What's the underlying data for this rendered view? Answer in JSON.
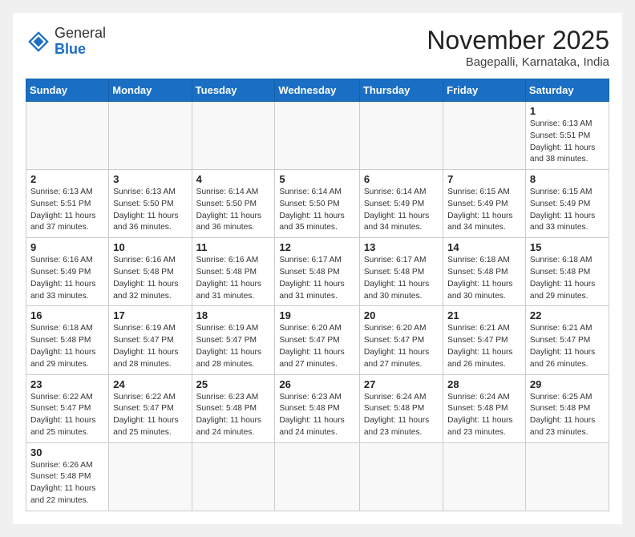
{
  "logo": {
    "general": "General",
    "blue": "Blue"
  },
  "header": {
    "month": "November 2025",
    "location": "Bagepalli, Karnataka, India"
  },
  "weekdays": [
    "Sunday",
    "Monday",
    "Tuesday",
    "Wednesday",
    "Thursday",
    "Friday",
    "Saturday"
  ],
  "weeks": [
    [
      {
        "day": "",
        "text": ""
      },
      {
        "day": "",
        "text": ""
      },
      {
        "day": "",
        "text": ""
      },
      {
        "day": "",
        "text": ""
      },
      {
        "day": "",
        "text": ""
      },
      {
        "day": "",
        "text": ""
      },
      {
        "day": "1",
        "text": "Sunrise: 6:13 AM\nSunset: 5:51 PM\nDaylight: 11 hours\nand 38 minutes."
      }
    ],
    [
      {
        "day": "2",
        "text": "Sunrise: 6:13 AM\nSunset: 5:51 PM\nDaylight: 11 hours\nand 37 minutes."
      },
      {
        "day": "3",
        "text": "Sunrise: 6:13 AM\nSunset: 5:50 PM\nDaylight: 11 hours\nand 36 minutes."
      },
      {
        "day": "4",
        "text": "Sunrise: 6:14 AM\nSunset: 5:50 PM\nDaylight: 11 hours\nand 36 minutes."
      },
      {
        "day": "5",
        "text": "Sunrise: 6:14 AM\nSunset: 5:50 PM\nDaylight: 11 hours\nand 35 minutes."
      },
      {
        "day": "6",
        "text": "Sunrise: 6:14 AM\nSunset: 5:49 PM\nDaylight: 11 hours\nand 34 minutes."
      },
      {
        "day": "7",
        "text": "Sunrise: 6:15 AM\nSunset: 5:49 PM\nDaylight: 11 hours\nand 34 minutes."
      },
      {
        "day": "8",
        "text": "Sunrise: 6:15 AM\nSunset: 5:49 PM\nDaylight: 11 hours\nand 33 minutes."
      }
    ],
    [
      {
        "day": "9",
        "text": "Sunrise: 6:16 AM\nSunset: 5:49 PM\nDaylight: 11 hours\nand 33 minutes."
      },
      {
        "day": "10",
        "text": "Sunrise: 6:16 AM\nSunset: 5:48 PM\nDaylight: 11 hours\nand 32 minutes."
      },
      {
        "day": "11",
        "text": "Sunrise: 6:16 AM\nSunset: 5:48 PM\nDaylight: 11 hours\nand 31 minutes."
      },
      {
        "day": "12",
        "text": "Sunrise: 6:17 AM\nSunset: 5:48 PM\nDaylight: 11 hours\nand 31 minutes."
      },
      {
        "day": "13",
        "text": "Sunrise: 6:17 AM\nSunset: 5:48 PM\nDaylight: 11 hours\nand 30 minutes."
      },
      {
        "day": "14",
        "text": "Sunrise: 6:18 AM\nSunset: 5:48 PM\nDaylight: 11 hours\nand 30 minutes."
      },
      {
        "day": "15",
        "text": "Sunrise: 6:18 AM\nSunset: 5:48 PM\nDaylight: 11 hours\nand 29 minutes."
      }
    ],
    [
      {
        "day": "16",
        "text": "Sunrise: 6:18 AM\nSunset: 5:48 PM\nDaylight: 11 hours\nand 29 minutes."
      },
      {
        "day": "17",
        "text": "Sunrise: 6:19 AM\nSunset: 5:47 PM\nDaylight: 11 hours\nand 28 minutes."
      },
      {
        "day": "18",
        "text": "Sunrise: 6:19 AM\nSunset: 5:47 PM\nDaylight: 11 hours\nand 28 minutes."
      },
      {
        "day": "19",
        "text": "Sunrise: 6:20 AM\nSunset: 5:47 PM\nDaylight: 11 hours\nand 27 minutes."
      },
      {
        "day": "20",
        "text": "Sunrise: 6:20 AM\nSunset: 5:47 PM\nDaylight: 11 hours\nand 27 minutes."
      },
      {
        "day": "21",
        "text": "Sunrise: 6:21 AM\nSunset: 5:47 PM\nDaylight: 11 hours\nand 26 minutes."
      },
      {
        "day": "22",
        "text": "Sunrise: 6:21 AM\nSunset: 5:47 PM\nDaylight: 11 hours\nand 26 minutes."
      }
    ],
    [
      {
        "day": "23",
        "text": "Sunrise: 6:22 AM\nSunset: 5:47 PM\nDaylight: 11 hours\nand 25 minutes."
      },
      {
        "day": "24",
        "text": "Sunrise: 6:22 AM\nSunset: 5:47 PM\nDaylight: 11 hours\nand 25 minutes."
      },
      {
        "day": "25",
        "text": "Sunrise: 6:23 AM\nSunset: 5:48 PM\nDaylight: 11 hours\nand 24 minutes."
      },
      {
        "day": "26",
        "text": "Sunrise: 6:23 AM\nSunset: 5:48 PM\nDaylight: 11 hours\nand 24 minutes."
      },
      {
        "day": "27",
        "text": "Sunrise: 6:24 AM\nSunset: 5:48 PM\nDaylight: 11 hours\nand 23 minutes."
      },
      {
        "day": "28",
        "text": "Sunrise: 6:24 AM\nSunset: 5:48 PM\nDaylight: 11 hours\nand 23 minutes."
      },
      {
        "day": "29",
        "text": "Sunrise: 6:25 AM\nSunset: 5:48 PM\nDaylight: 11 hours\nand 23 minutes."
      }
    ],
    [
      {
        "day": "30",
        "text": "Sunrise: 6:26 AM\nSunset: 5:48 PM\nDaylight: 11 hours\nand 22 minutes."
      },
      {
        "day": "",
        "text": ""
      },
      {
        "day": "",
        "text": ""
      },
      {
        "day": "",
        "text": ""
      },
      {
        "day": "",
        "text": ""
      },
      {
        "day": "",
        "text": ""
      },
      {
        "day": "",
        "text": ""
      }
    ]
  ]
}
